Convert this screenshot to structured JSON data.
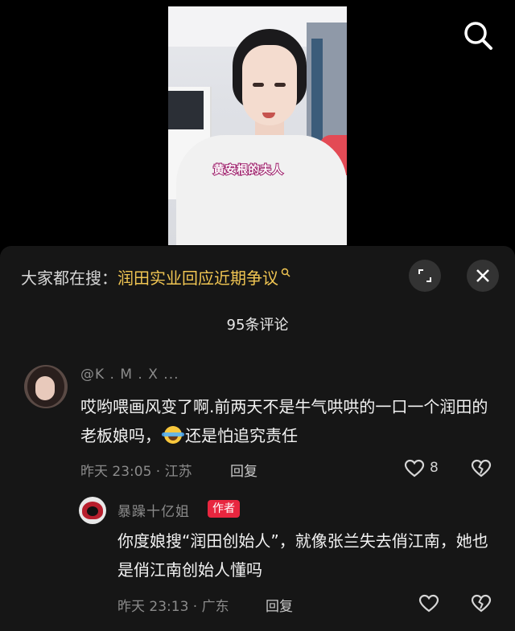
{
  "video": {
    "caption": "黄安根的夫人"
  },
  "icons": {
    "search": "search-icon",
    "expand": "expand-icon",
    "close": "close-icon",
    "heart": "heart-icon",
    "broken_heart": "broken-heart-icon"
  },
  "hot_search": {
    "prefix": "大家都在搜：",
    "topic": "润田实业回应近期争议"
  },
  "comment_count": "95条评论",
  "comments": [
    {
      "username": "@K . M . X ...",
      "text_before_emoji": "哎哟喂画风变了啊.前两天不是牛气哄哄的一口一个润田的老板娘吗，",
      "text_after_emoji": "还是怕追究责任",
      "meta": "昨天 23:05 · 江苏",
      "reply_label": "回复",
      "likes": "8"
    }
  ],
  "reply": {
    "username": "暴躁十亿姐",
    "badge": "作者",
    "text": "你度娘搜“润田创始人”，就像张兰失去俏江南，她也是俏江南创始人懂吗",
    "meta": "昨天 23:13 · 广东",
    "reply_label": "回复"
  },
  "colors": {
    "accent_topic": "#f0c552",
    "author_badge": "#e8263f",
    "panel_bg": "#161616"
  }
}
